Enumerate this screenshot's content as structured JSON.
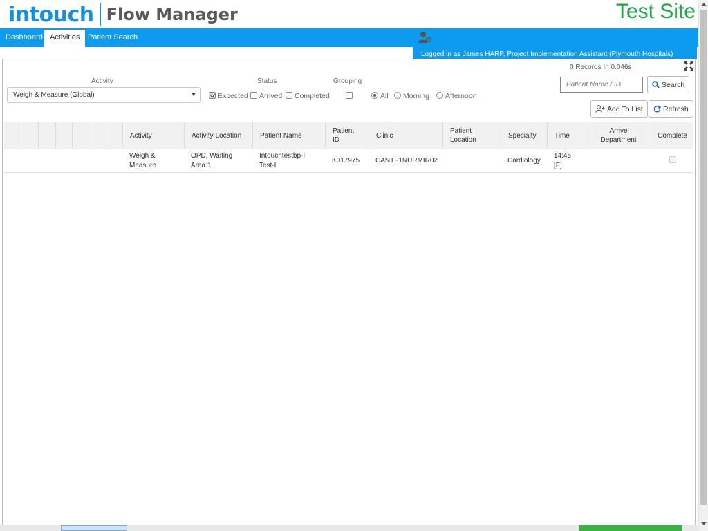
{
  "header": {
    "logo_brand": "intouch",
    "logo_product": "Flow Manager",
    "site_label": "Test Site"
  },
  "nav": {
    "tabs": [
      {
        "label": "Dashboard",
        "active": false
      },
      {
        "label": "Activities",
        "active": true
      },
      {
        "label": "Patient Search",
        "active": false
      }
    ],
    "logged_in": "Logged in as James HARP, Project Implementation Assistant (Plymouth Hospitals)",
    "user_icon": "user-settings-icon"
  },
  "filters": {
    "records_text": "0 Records In 0.046s",
    "activity_label": "Activity",
    "activity_value": "Weigh & Measure (Global)",
    "status_label": "Status",
    "status_options": [
      {
        "label": "Expected",
        "checked": true
      },
      {
        "label": "Arrived",
        "checked": false
      },
      {
        "label": "Completed",
        "checked": false
      }
    ],
    "grouping_label": "Grouping",
    "grouping_checked": false,
    "time_options": [
      {
        "label": "All",
        "checked": true
      },
      {
        "label": "Morning",
        "checked": false
      },
      {
        "label": "Afternoon",
        "checked": false
      }
    ],
    "search_placeholder": "Patient Name / ID",
    "search_button": "Search",
    "add_to_list_button": "Add To List",
    "refresh_button": "Refresh"
  },
  "table": {
    "columns": [
      "Activity",
      "Activity Location",
      "Patient Name",
      "Patient ID",
      "Clinic",
      "Patient Location",
      "Specialty",
      "Time",
      "Arrive Department",
      "Complete"
    ],
    "rows": [
      {
        "activity": "Weigh & Measure",
        "activity_location": "OPD, Waiting Area 1",
        "patient_name": "Intouchtestbp-I Test-I",
        "patient_id": "K017975",
        "clinic": "CANTF1NURMIR02",
        "patient_location": "",
        "specialty": "Cardiology",
        "time": "14:45 [F]",
        "arrive_department": "",
        "complete": false
      }
    ]
  },
  "colors": {
    "brand_blue": "#1a8fd6",
    "nav_blue": "#0d9bf0",
    "site_green": "#22a347"
  }
}
